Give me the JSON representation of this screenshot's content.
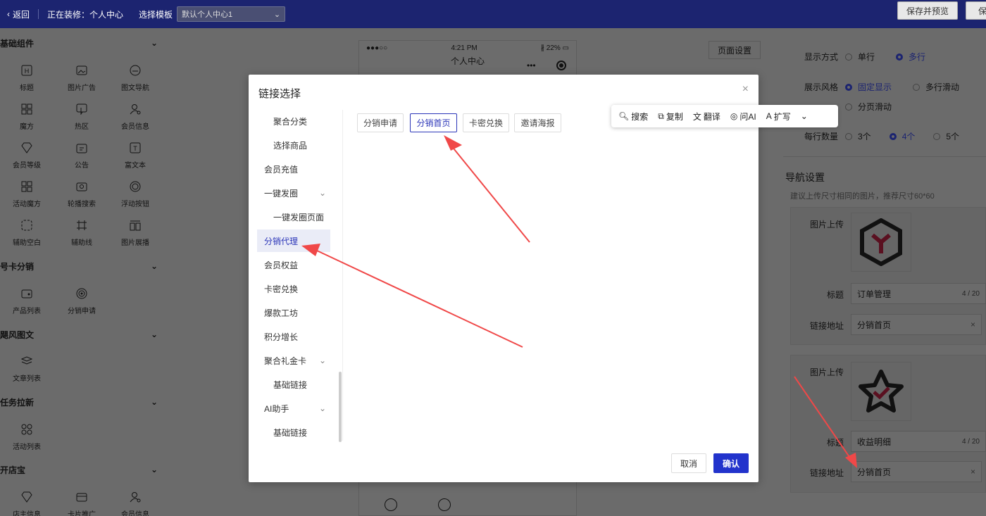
{
  "topbar": {
    "back_label": "返回",
    "editing_label": "正在装修：个人中心",
    "template_label": "选择模板",
    "template_value": "默认个人中心1",
    "save_preview_label": "保存并预览",
    "save_label": "保存"
  },
  "left_panel": {
    "sections": [
      {
        "title": "基础组件",
        "items": [
          "标题",
          "图片广告",
          "图文导航",
          "魔方",
          "热区",
          "会员信息",
          "会员等级",
          "公告",
          "富文本",
          "活动魔方",
          "轮播搜索",
          "浮动按钮",
          "辅助空白",
          "辅助线",
          "图片展播"
        ]
      },
      {
        "title": "号卡分销",
        "items": [
          "产品列表",
          "分销申请"
        ]
      },
      {
        "title": "飓风图文",
        "items": [
          "文章列表"
        ]
      },
      {
        "title": "任务拉新",
        "items": [
          "活动列表"
        ]
      },
      {
        "title": "开店宝",
        "items": [
          "店主信息",
          "卡片推广",
          "会员信息"
        ]
      }
    ]
  },
  "phone": {
    "carrier": "●●●○○",
    "time": "4:21 PM",
    "battery": "22%",
    "title": "个人中心"
  },
  "page_settings_label": "页面设置",
  "right_panel": {
    "display_mode_label": "显示方式",
    "display_mode_options": [
      "单行",
      "多行"
    ],
    "display_style_label": "展示风格",
    "display_style_options": [
      "固定显示",
      "多行滑动",
      "分页滑动"
    ],
    "per_row_label": "每行数量",
    "per_row_options": [
      "3个",
      "4个",
      "5个"
    ],
    "nav_settings_title": "导航设置",
    "nav_settings_hint": "建议上传尺寸相同的图片，推荐尺寸60*60",
    "cards": [
      {
        "upload_label": "图片上传",
        "title_label": "标题",
        "title_value": "订单管理",
        "title_count": "4 / 20",
        "link_label": "链接地址",
        "link_value": "分销首页"
      },
      {
        "upload_label": "图片上传",
        "title_label": "标题",
        "title_value": "收益明细",
        "title_count": "4 / 20",
        "link_label": "链接地址",
        "link_value": "分销首页"
      }
    ]
  },
  "modal": {
    "title": "链接选择",
    "nav_items": [
      {
        "label": "聚合分类",
        "sub": true
      },
      {
        "label": "选择商品",
        "sub": true
      },
      {
        "label": "会员充值",
        "sub": false
      },
      {
        "label": "一键发圈",
        "sub": false,
        "chevron": true
      },
      {
        "label": "一键发圈页面",
        "sub": true
      },
      {
        "label": "分销代理",
        "sub": false,
        "active": true
      },
      {
        "label": "会员权益",
        "sub": false
      },
      {
        "label": "卡密兑换",
        "sub": false
      },
      {
        "label": "爆款工坊",
        "sub": false
      },
      {
        "label": "积分增长",
        "sub": false
      },
      {
        "label": "聚合礼金卡",
        "sub": false,
        "chevron": true
      },
      {
        "label": "基础链接",
        "sub": true
      },
      {
        "label": "AI助手",
        "sub": false,
        "chevron": true
      },
      {
        "label": "基础链接",
        "sub": true
      }
    ],
    "tags": [
      "分销申请",
      "分销首页",
      "卡密兑换",
      "邀请海报"
    ],
    "active_tag": "分销首页",
    "cancel_label": "取消",
    "confirm_label": "确认"
  },
  "floating_toolbar": {
    "items": [
      "搜索",
      "复制",
      "翻译",
      "问AI",
      "扩写"
    ]
  },
  "colors": {
    "brand": "#1c2470",
    "accent": "#2b35b8",
    "arrow": "#f04848"
  }
}
